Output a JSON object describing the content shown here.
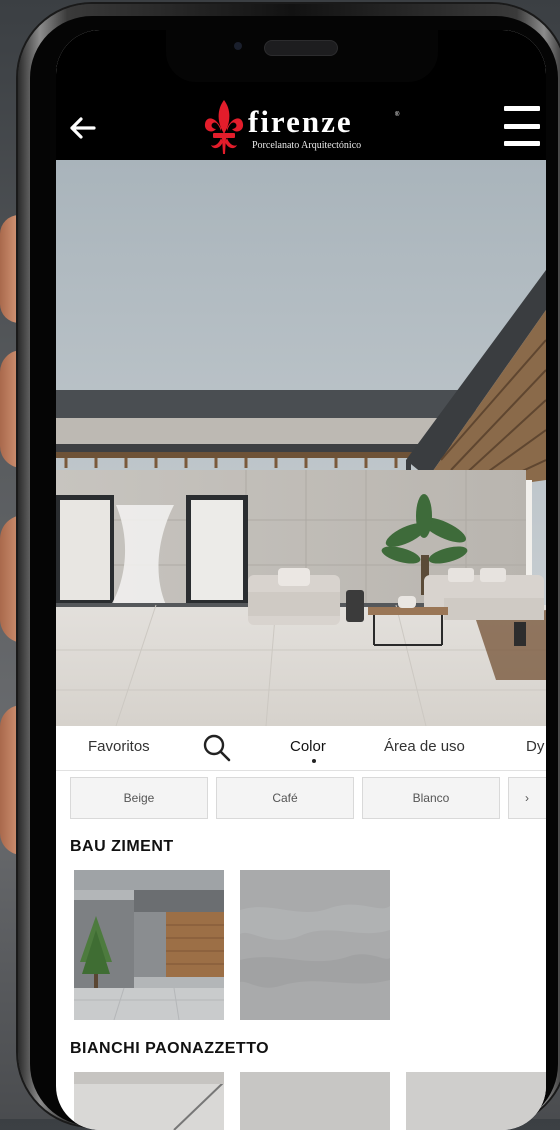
{
  "header": {
    "brand_name": "firenze",
    "brand_tagline": "Porcelanato Arquitectónico",
    "brand_color": "#e31d2b"
  },
  "icons": {
    "back": "arrow-left-icon",
    "menu": "hamburger-menu-icon",
    "search": "search-icon",
    "logo": "fleur-de-lis-icon"
  },
  "tabs": [
    {
      "label": "Favoritos"
    },
    {
      "label": "Color",
      "active": true
    },
    {
      "label": "Área de uso"
    },
    {
      "label": "Dy"
    }
  ],
  "filters": [
    {
      "label": "Beige"
    },
    {
      "label": "Café"
    },
    {
      "label": "Blanco"
    },
    {
      "label": ""
    }
  ],
  "collections": [
    {
      "name": "BAU ZIMENT"
    },
    {
      "name": "BIANCHI PAONAZZETTO"
    }
  ],
  "colors": {
    "header_bg": "#000000",
    "chip_bg": "#f4f4f4",
    "chip_border": "#d9d9d9",
    "text": "#111111"
  }
}
